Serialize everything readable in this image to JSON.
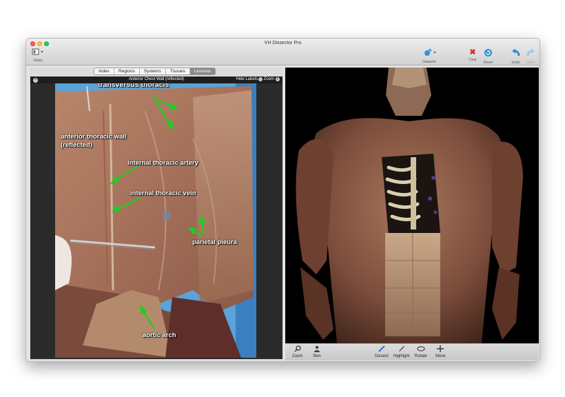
{
  "window": {
    "title": "VH Dissector Pro"
  },
  "toolbar": {
    "views_label": "Views",
    "datasets_label": "Datasets",
    "clear_label": "Clear",
    "reset_label": "Reset",
    "undo_label": "Undo",
    "redo_label": "Redo"
  },
  "tabs": [
    {
      "label": "Index"
    },
    {
      "label": "Regions"
    },
    {
      "label": "Systems"
    },
    {
      "label": "Tissues"
    },
    {
      "label": "Lessons",
      "active": true
    }
  ],
  "viewer": {
    "title": "Anterior Chest Wall (reflected)",
    "hide_labels": "Hide Labels",
    "zoom": "Zoom"
  },
  "annotations": {
    "transversus_thoracis": "transversus thoracis",
    "anterior_wall_1": "anterior thoracic wall",
    "anterior_wall_2": "(reflected)",
    "internal_thoracic_artery": "internal thoracic artery",
    "internal_thoracic_vein": "internal thoracic vein",
    "parietal_pleura": "parietal pleura",
    "aortic_arch": "aortic arch"
  },
  "bottom_tools": {
    "zoom": "Zoom",
    "skin": "Skin",
    "dissect": "Dissect",
    "highlight": "Highlight",
    "rotate": "Rotate",
    "move": "Move"
  },
  "colors": {
    "arrow": "#22cc22",
    "tab_active": "#8a8a8a",
    "clear_red": "#d92c2c",
    "reset_blue": "#2b8fd6"
  },
  "icons": {
    "views": "views-icon",
    "datasets": "datasets-icon",
    "clear": "x-icon",
    "reset": "reset-icon",
    "undo": "undo-arrow-icon",
    "redo": "redo-arrow-icon",
    "zoom": "magnifier-icon",
    "skin": "person-icon",
    "dissect": "scalpel-icon",
    "highlight": "pencil-icon",
    "rotate": "rotate-icon",
    "move": "move-cross-icon"
  }
}
